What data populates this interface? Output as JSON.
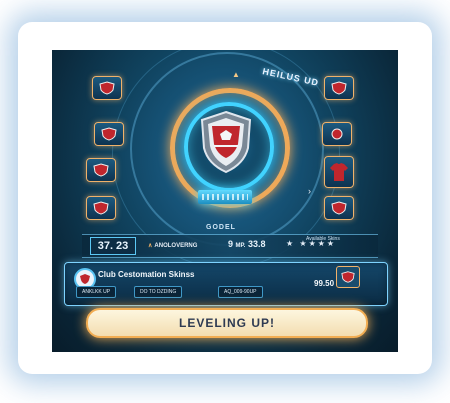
{
  "hud": {
    "title": "HEILUS UD",
    "arrow": "▲",
    "mode_label": "GODEL"
  },
  "stats": {
    "level": "37. 23",
    "mode": "ANOLOVERNG",
    "mode_chevron": "∧",
    "mp_value": "9",
    "mp_unit": "MP.",
    "mp_score": "33.8",
    "stars": "★ ★★★★",
    "skins_label": "Available Skins"
  },
  "panel": {
    "title": "Club Cestomation Skinss",
    "btn_1": "ANKLKK UP",
    "btn_2": "DO TO DZDING",
    "btn_3": "AQ_009-90UP",
    "price": "99.50"
  },
  "action": {
    "label": "LEVELING UP!"
  },
  "nav": {
    "right_arrow": "›"
  },
  "colors": {
    "accent_orange": "#f1a857",
    "accent_cyan": "#41d3ff",
    "crest_red": "#c0262d",
    "background_navy": "#0a2638"
  },
  "icons": {
    "center": "team-crest-icon",
    "tiles": [
      "crest-tile-icon",
      "jersey-tile-icon"
    ]
  }
}
